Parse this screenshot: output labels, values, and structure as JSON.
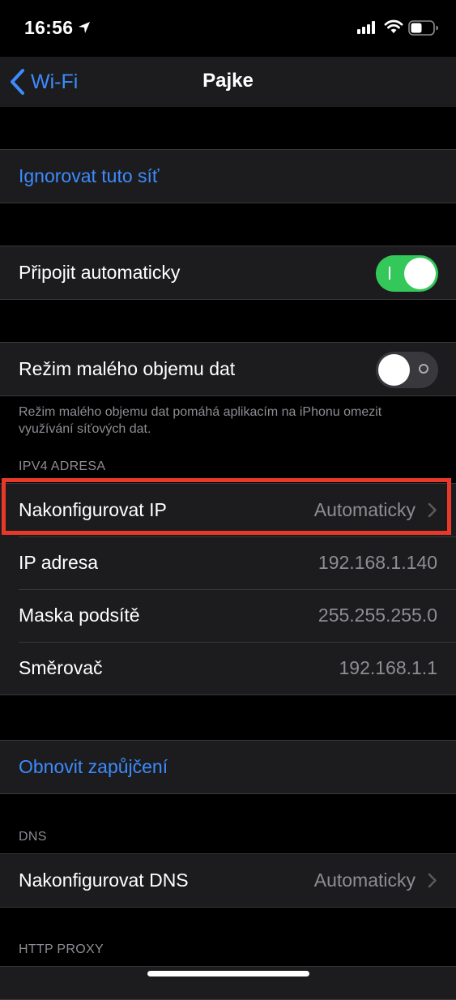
{
  "status_bar": {
    "time": "16:56"
  },
  "nav": {
    "back_label": "Wi-Fi",
    "title": "Pajke"
  },
  "forget_network": {
    "label": "Ignorovat tuto síť"
  },
  "auto_join": {
    "label": "Připojit automaticky",
    "enabled": true
  },
  "low_data_mode": {
    "label": "Režim malého objemu dat",
    "enabled": false,
    "footer": "Režim malého objemu dat pomáhá aplikacím na iPhonu omezit využívání síťových dat."
  },
  "ipv4": {
    "header": "IPV4 ADRESA",
    "configure_ip": {
      "label": "Nakonfigurovat IP",
      "value": "Automaticky"
    },
    "ip_address": {
      "label": "IP adresa",
      "value": "192.168.1.140"
    },
    "subnet_mask": {
      "label": "Maska podsítě",
      "value": "255.255.255.0"
    },
    "router": {
      "label": "Směrovač",
      "value": "192.168.1.1"
    }
  },
  "renew_lease": {
    "label": "Obnovit zapůjčení"
  },
  "dns": {
    "header": "DNS",
    "configure_dns": {
      "label": "Nakonfigurovat DNS",
      "value": "Automaticky"
    }
  },
  "http_proxy": {
    "header": "HTTP PROXY"
  },
  "colors": {
    "accent": "#3d8bfd",
    "toggle_on": "#34c759",
    "highlight": "#e8382a"
  }
}
